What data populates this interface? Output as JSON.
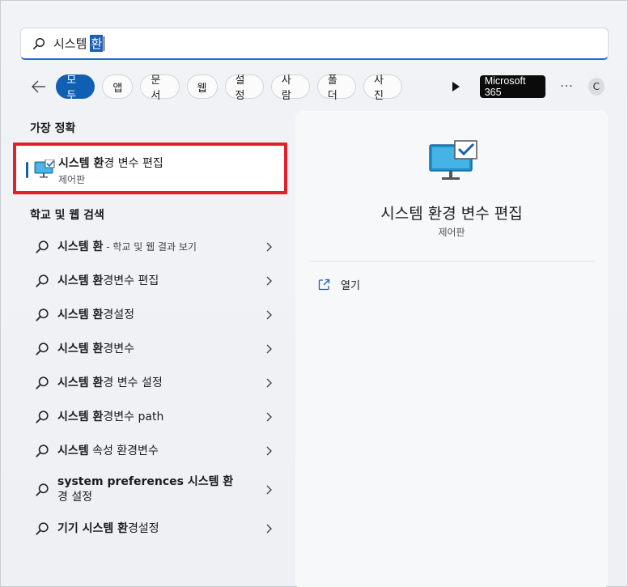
{
  "search": {
    "query_prefix": "시스템",
    "query_selected": "환"
  },
  "filters": {
    "chips": [
      "모두",
      "앱",
      "문서",
      "웹",
      "설정",
      "사람",
      "폴더",
      "사진"
    ],
    "active_index": 0,
    "ms365_label": "Microsoft 365",
    "more_label": "···",
    "avatar_initial": "C"
  },
  "best_match": {
    "section_title": "가장 정확",
    "title_bold": "시스템 환",
    "title_rest": "경 변수 편집",
    "subtitle": "제어판"
  },
  "web_search": {
    "section_title": "학교 및 웹 검색",
    "items": [
      {
        "bold": "시스템 환",
        "rest": "",
        "suffix": " - 학교 및 웹 결과 보기"
      },
      {
        "bold": "시스템 환",
        "rest": "경변수 편집",
        "suffix": ""
      },
      {
        "bold": "시스템 환",
        "rest": "경설정",
        "suffix": ""
      },
      {
        "bold": "시스템 환",
        "rest": "경변수",
        "suffix": ""
      },
      {
        "bold": "시스템 환",
        "rest": "경 변수 설정",
        "suffix": ""
      },
      {
        "bold": "시스템 환",
        "rest": "경변수 path",
        "suffix": ""
      },
      {
        "bold": "시스템",
        "rest": " 속성 환경변수",
        "suffix": ""
      },
      {
        "bold": "system preferences 시스템 환",
        "rest": "경 설정",
        "suffix": ""
      },
      {
        "bold": "기기 시스템 환",
        "rest": "경설정",
        "suffix": ""
      }
    ]
  },
  "preview": {
    "title": "시스템 환경 변수 편집",
    "subtitle": "제어판",
    "open_label": "열기"
  },
  "colors": {
    "accent": "#0f5fb3",
    "highlight_border": "#e2202b"
  }
}
